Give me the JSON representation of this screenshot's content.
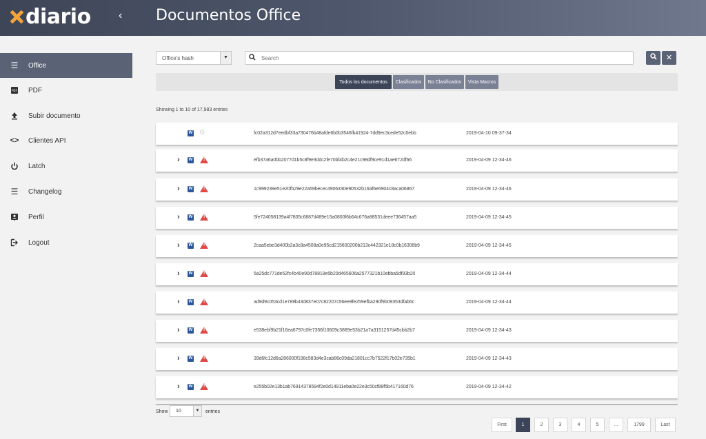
{
  "header": {
    "logo_text": "diario",
    "collapse_glyph": "‹",
    "page_title": "Documentos Office"
  },
  "sidebar": {
    "items": [
      {
        "label": "Office",
        "icon": "list-icon"
      },
      {
        "label": "PDF",
        "icon": "pdf-icon"
      },
      {
        "label": "Subir documento",
        "icon": "upload-icon"
      },
      {
        "label": "Clientes API",
        "icon": "code-icon"
      },
      {
        "label": "Latch",
        "icon": "power-icon"
      },
      {
        "label": "Changelog",
        "icon": "list-icon"
      },
      {
        "label": "Perfil",
        "icon": "profile-icon"
      },
      {
        "label": "Logout",
        "icon": "logout-icon"
      }
    ]
  },
  "toolbar": {
    "hash_select": "Office's hash",
    "search_placeholder": "Search",
    "search_button_glyph": "⚲",
    "clear_button_glyph": "✕"
  },
  "filters": {
    "all": "Todos los documentos",
    "classified": "Clasificados",
    "unclassified": "No Clasificados",
    "macros": "Vista Macros"
  },
  "table": {
    "showing": "Showing 1 to 10 of 17,983 entries",
    "rows": [
      {
        "hash": "fc02a312d7eedbf33a730476b48afde6b0b3546fb41924-7dd9ec3cede52c0ebb",
        "date": "2019-04-10 09-37-34"
      },
      {
        "hash": "efb37a6a0bb2077d1b5c8f9e3ddc2fe70bf4b2c4e21c98df9ce91d1ae672df66",
        "date": "2019-04-09 12-34-46"
      },
      {
        "hash": "1c999239e51e20fb29e22a59becec4906330e90532b16af6e6904c8aca06867",
        "date": "2019-04-09 12-34-46"
      },
      {
        "hash": "5fe724058139a4f7805c6887d489e15a0800f6b64c676a88531deee736457aa5",
        "date": "2019-04-09 12-34-45"
      },
      {
        "hash": "2caa5ebe3d400b2a3c8a4508a0e95cd215600200b213c442321e18c0b16306b9",
        "date": "2019-04-09 12-34-45"
      },
      {
        "hash": "5a25dc771de52fc4b40e90d78819e5b20d465606a2577321b10ebba5df93b20",
        "date": "2019-04-09 12-34-44"
      },
      {
        "hash": "ad9d9c053cd1e789b43d837e07c82207c56ee9fe259efba290f9b09353dfab6c",
        "date": "2019-04-09 12-34-44"
      },
      {
        "hash": "e538ebf9b21f16ea6797c0fe7356f10609c3869e53b21a7a3151257d45cbb2b7",
        "date": "2019-04-09 12-34-43"
      },
      {
        "hash": "39d6fc12d6a286000f198c583d4e3cab86c09da21801cc7b7522f17b02e735b1",
        "date": "2019-04-09 12-34-43"
      },
      {
        "hash": "e255b02e13b1ab76914378594f2e0d14911eba0e22e3c50cf88f5b417160d76",
        "date": "2019-04-09 12-34-42"
      }
    ]
  },
  "footer": {
    "show_label": "Show",
    "entries_value": "10",
    "entries_label": "entries",
    "pages": [
      "First",
      "1",
      "2",
      "3",
      "4",
      "5",
      "...",
      "1799",
      "Last"
    ],
    "active_page": "1"
  }
}
